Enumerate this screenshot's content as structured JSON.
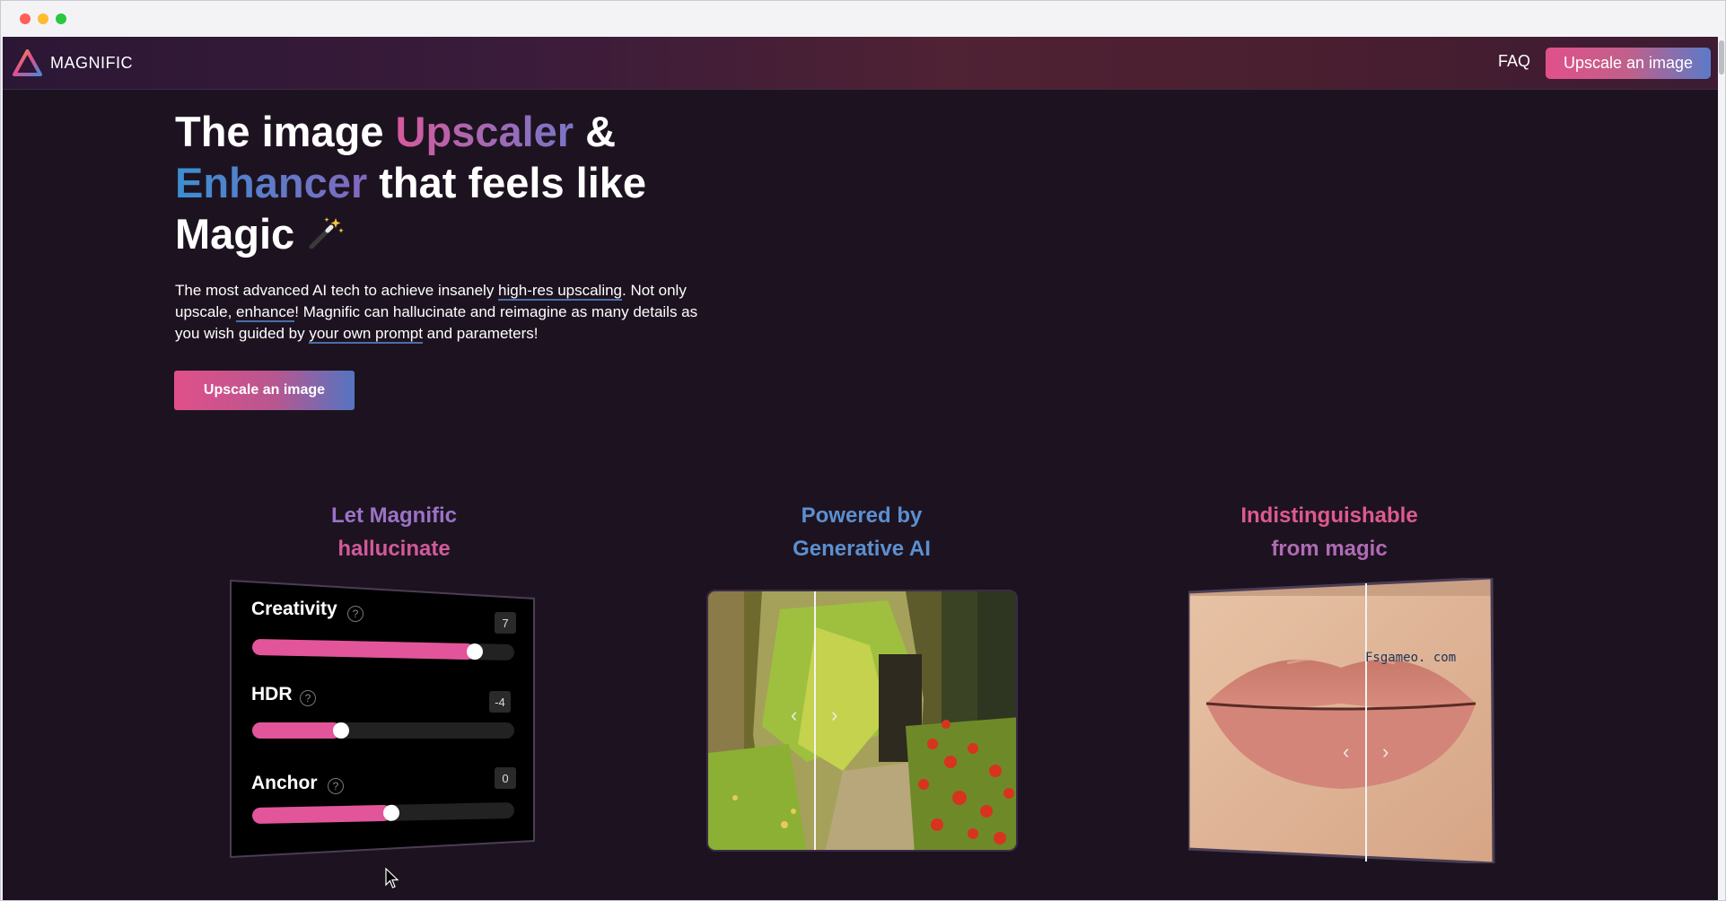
{
  "nav": {
    "brand": "MAGNIFIC",
    "faq_label": "FAQ",
    "cta_label": "Upscale an image"
  },
  "hero": {
    "title_part1": "The image ",
    "title_upscaler": "Upscaler",
    "title_part2": " &",
    "title_enhancer": "Enhancer",
    "title_part3": " that feels like",
    "title_magic": "Magic ",
    "desc_1": "The most advanced AI tech to achieve insanely ",
    "desc_link1": "high-res upscaling",
    "desc_2": ". Not only upscale, ",
    "desc_link2": "enhance",
    "desc_3": "! Magnific can hallucinate and reimagine as many details as you wish guided by ",
    "desc_link3": "your own prompt",
    "desc_4": " and parameters!",
    "cta_label": "Upscale an image"
  },
  "features": [
    {
      "line1": "Let Magnific",
      "line2": "hallucinate"
    },
    {
      "line1": "Powered by",
      "line2": "Generative AI"
    },
    {
      "line1": "Indistinguishable",
      "line2": "from magic"
    }
  ],
  "sliders": [
    {
      "label": "Creativity",
      "value": "7",
      "fraction": 0.85
    },
    {
      "label": "HDR",
      "value": "-4",
      "fraction": 0.34
    },
    {
      "label": "Anchor",
      "value": "0",
      "fraction": 0.53
    }
  ],
  "help_glyph": "?",
  "compare_arrows": {
    "left": "‹",
    "right": "›"
  },
  "watermark": "Fsgameo. com",
  "colors": {
    "background": "#1d1320",
    "accent_pink": "#e2559a",
    "accent_blue": "#5474c2"
  },
  "icons": [
    "logo-triangle-icon",
    "magic-wand-icon",
    "help-circle-icon",
    "chevron-left-icon",
    "chevron-right-icon",
    "cursor-icon"
  ]
}
